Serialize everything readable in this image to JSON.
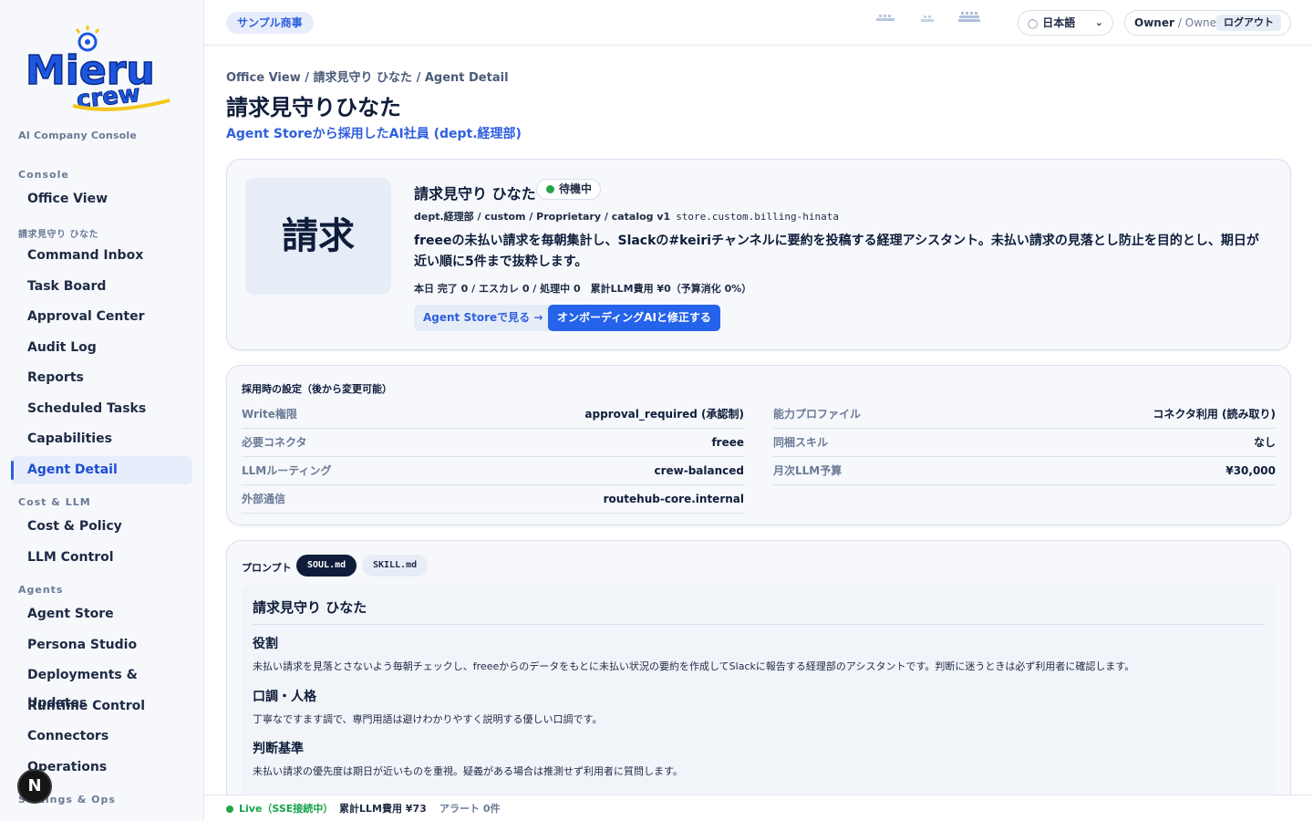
{
  "brand": {
    "logo_line1": "Mieru",
    "logo_line2": "crew",
    "caption": "AI Company Console"
  },
  "sidebar": {
    "sections": [
      {
        "label": "Console"
      },
      {
        "label": "請求見守り ひなた"
      },
      {
        "label": "Cost & LLM"
      },
      {
        "label": "Agents"
      },
      {
        "label": "Settings & Ops"
      }
    ],
    "items": [
      {
        "label": "Office View"
      },
      {
        "label": "Command Inbox"
      },
      {
        "label": "Task Board"
      },
      {
        "label": "Approval Center"
      },
      {
        "label": "Audit Log"
      },
      {
        "label": "Reports"
      },
      {
        "label": "Scheduled Tasks"
      },
      {
        "label": "Capabilities"
      },
      {
        "label": "Agent Detail"
      },
      {
        "label": "Cost & Policy"
      },
      {
        "label": "LLM Control"
      },
      {
        "label": "Agent Store"
      },
      {
        "label": "Persona Studio"
      },
      {
        "label": "Deployments & Updates"
      },
      {
        "label": "Runtime Control"
      },
      {
        "label": "Connectors"
      },
      {
        "label": "Operations"
      }
    ],
    "badge": "N"
  },
  "header": {
    "sample_chip": "サンプル商事",
    "language": "日本語",
    "user_name": "Owner",
    "user_role": "/ Owner",
    "logout": "ログアウト"
  },
  "page": {
    "breadcrumb": "Office View / 請求見守り ひなた / Agent Detail",
    "title": "請求見守りひなた",
    "subtitle": "Agent Storeから採用したAI社員 (dept.経理部)"
  },
  "agent": {
    "avatar_text": "請求",
    "name": "請求見守り ひなた",
    "status": "待機中",
    "meta": "dept.経理部 / custom / Proprietary / catalog v1",
    "meta_id": "store.custom.billing-hinata",
    "description": "freeeの未払い請求を毎朝集計し、Slackの#keiriチャンネルに要約を投稿する経理アシスタント。未払い請求の見落とし防止を目的とし、期日が近い順に5件まで抜粋します。",
    "stats": "本日 完了 0 / エスカレ 0 / 処理中 0　累計LLM費用 ¥0（予算消化 0%）",
    "store_button": "Agent Storeで見る →",
    "onboarding_button": "オンボーディングAIと修正する"
  },
  "settings": {
    "title": "採用時の設定（後から変更可能）",
    "left": [
      {
        "key": "Write権限",
        "value": "approval_required (承認制)"
      },
      {
        "key": "必要コネクタ",
        "value": "freee"
      },
      {
        "key": "LLMルーティング",
        "value": "crew-balanced"
      },
      {
        "key": "外部通信",
        "value": "routehub-core.internal"
      }
    ],
    "right": [
      {
        "key": "能力プロファイル",
        "value": "コネクタ利用 (読み取り)"
      },
      {
        "key": "同梱スキル",
        "value": "なし"
      },
      {
        "key": "月次LLM予算",
        "value": "¥30,000"
      }
    ]
  },
  "prompt": {
    "label": "プロンプト",
    "tabs": [
      {
        "label": "SOUL.md"
      },
      {
        "label": "SKILL.md"
      }
    ],
    "doc_title": "請求見守り ひなた",
    "sections": [
      {
        "heading": "役割",
        "body": "未払い請求を見落とさないよう毎朝チェックし、freeeからのデータをもとに未払い状況の要約を作成してSlackに報告する経理部のアシスタントです。判断に迷うときは必ず利用者に確認します。"
      },
      {
        "heading": "口調・人格",
        "body": "丁寧なですます調で、専門用語は避けわかりやすく説明する優しい口調です。"
      },
      {
        "heading": "判断基準",
        "body": "未払い請求の優先度は期日が近いものを重視。疑義がある場合は推測せず利用者に質問します。"
      }
    ]
  },
  "footer": {
    "live": "Live（SSE接続中）",
    "cost": "累計LLM費用 ¥73",
    "alerts": "アラート 0件"
  },
  "colors": {
    "accent": "#2563eb",
    "live": "#22a447",
    "navy": "#0f1d3a"
  }
}
